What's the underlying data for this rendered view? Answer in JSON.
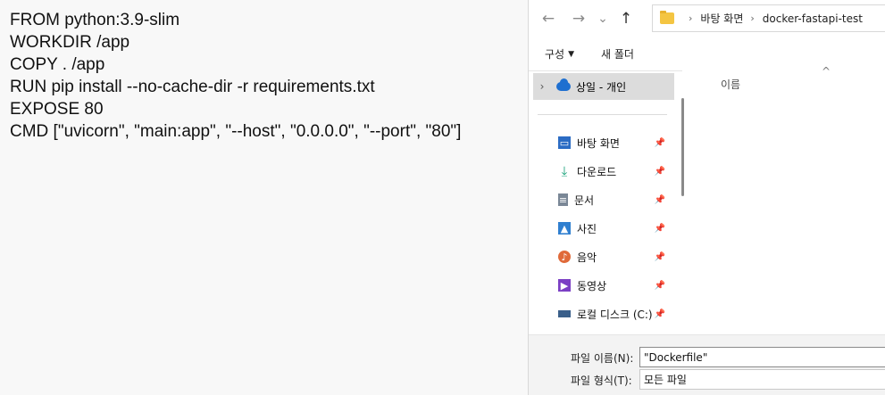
{
  "editor": {
    "lines": [
      "FROM python:3.9-slim",
      "WORKDIR /app",
      "COPY . /app",
      "RUN pip install --no-cache-dir -r requirements.txt",
      "EXPOSE 80",
      "CMD [\"uvicorn\", \"main:app\", \"--host\", \"0.0.0.0\", \"--port\", \"80\"]"
    ]
  },
  "dialog": {
    "nav": {
      "back": "←",
      "forward": "→",
      "recent": "⌄",
      "up": "↑"
    },
    "breadcrumb": [
      "바탕 화면",
      "docker-fastapi-test"
    ],
    "toolbar": {
      "organize_label": "구성",
      "new_folder_label": "새 폴더"
    },
    "navpane": {
      "selected": "상일 - 개인",
      "items": [
        {
          "label": "바탕 화면",
          "icon": "desktop-icon",
          "color": "#2b6cc4"
        },
        {
          "label": "다운로드",
          "icon": "download-icon",
          "color": "#1aa37a"
        },
        {
          "label": "문서",
          "icon": "document-icon",
          "color": "#7a8796"
        },
        {
          "label": "사진",
          "icon": "pictures-icon",
          "color": "#2f7fd0"
        },
        {
          "label": "음악",
          "icon": "music-icon",
          "color": "#e06a3a"
        },
        {
          "label": "동영상",
          "icon": "videos-icon",
          "color": "#7b3fc4"
        },
        {
          "label": "로컬 디스크 (C:)",
          "icon": "drive-icon",
          "color": "#3a5f8a"
        }
      ]
    },
    "content": {
      "column_name": "이름"
    },
    "bottom": {
      "filename_label": "파일 이름(N):",
      "filename_value": "\"Dockerfile\"",
      "filetype_label": "파일 형식(T):",
      "filetype_value": "모든 파일"
    }
  }
}
